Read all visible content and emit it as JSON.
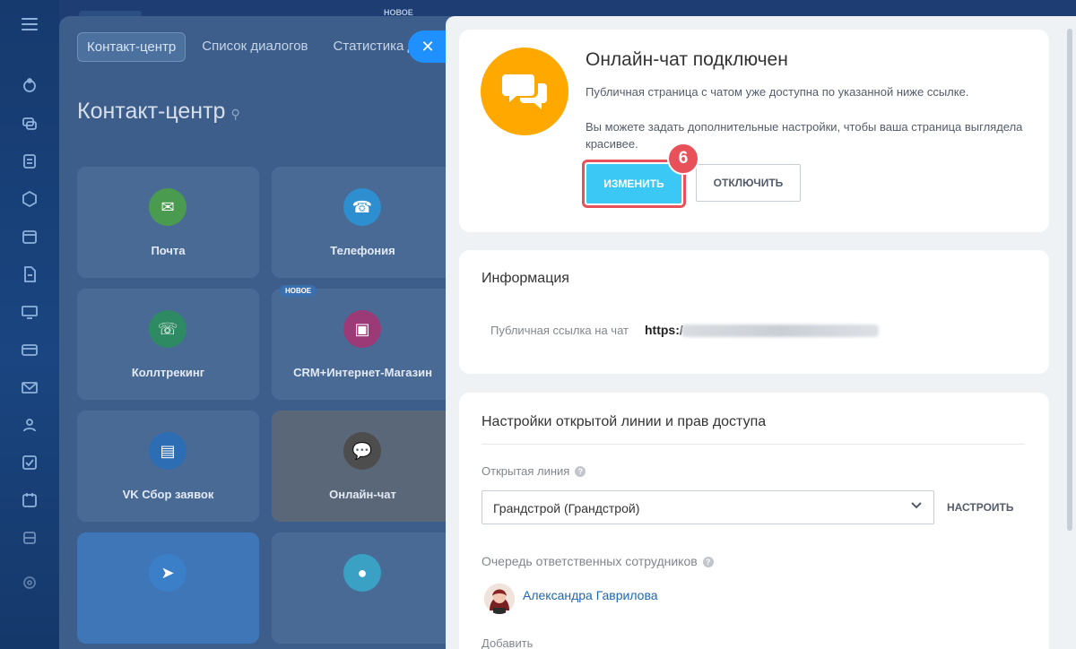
{
  "sidebar_icons": [
    "burger-icon",
    "sync-icon",
    "chat-icon",
    "tasks-icon",
    "shield-icon",
    "calendar-icon",
    "document-icon",
    "monitor-icon",
    "card-icon",
    "mail-icon",
    "users-icon",
    "check-icon",
    "planner-icon",
    "storage-icon",
    "settings-icon"
  ],
  "background": {
    "tabs": [
      "Контакт-центр",
      "Список диалогов",
      "Статистика ди"
    ],
    "title": "Контакт-центр",
    "new_badge": "НОВОЕ",
    "tiles": [
      {
        "label": "Почта",
        "color": "#4a9b4f"
      },
      {
        "label": "Телефония",
        "color": "#2d8fcf"
      },
      {
        "label": "Коллтрекинг",
        "color": "#2e8a63"
      },
      {
        "label": "CRM+Интернет-Магазин",
        "color": "#9c3a78"
      },
      {
        "label": "VK Сбор заявок",
        "color": "#2d6db4"
      },
      {
        "label": "Онлайн-чат",
        "color": "#4d4d4d"
      },
      {
        "label": "",
        "color": "#3a7fc8"
      },
      {
        "label": "",
        "color": "#3aa0c4"
      }
    ]
  },
  "close_label": "✕",
  "status_card": {
    "title": "Онлайн-чат подключен",
    "text1": "Публичная страница с чатом уже доступна по указанной ниже ссылке.",
    "text2": "Вы можете задать дополнительные настройки, чтобы ваша страница выглядела красивее.",
    "edit_button": "ИЗМЕНИТЬ",
    "disable_button": "ОТКЛЮЧИТЬ",
    "step_number": "6",
    "icon_color": "#ffa800"
  },
  "info_card": {
    "title": "Информация",
    "public_link_label": "Публичная ссылка на чат",
    "public_link_value": "https:/"
  },
  "settings_card": {
    "title": "Настройки открытой линии и прав доступа",
    "open_line_label": "Открытая линия",
    "open_line_value": "Грандстрой (Грандстрой)",
    "setup_button": "НАСТРОИТЬ",
    "queue_label": "Очередь ответственных сотрудников",
    "person": "Александра Гаврилова",
    "add_label": "Добавить",
    "help_glyph": "?"
  },
  "colors": {
    "accent": "#3bc8f5",
    "highlight": "#e8515a",
    "link": "#2067b0"
  }
}
